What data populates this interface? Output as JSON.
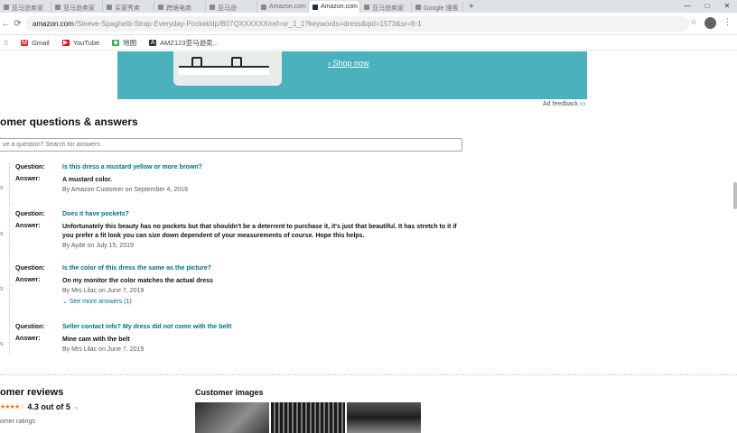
{
  "browser": {
    "tabs": [
      {
        "label": "亚马逊卖家",
        "active": false
      },
      {
        "label": "亚马逊卖家",
        "active": false
      },
      {
        "label": "买家秀卖",
        "active": false
      },
      {
        "label": "跨境电商",
        "active": false
      },
      {
        "label": "亚马逊",
        "active": false
      },
      {
        "label": "Amazon.com",
        "active": false
      },
      {
        "label": "Amazon.com",
        "active": true
      },
      {
        "label": "亚马逊卖家",
        "active": false
      },
      {
        "label": "Google 搜索",
        "active": false
      }
    ],
    "new_tab": "+",
    "controls": {
      "minimize": "—",
      "maximize": "□",
      "close": "✕"
    },
    "nav": {
      "back": "←",
      "forward": "→",
      "reload": "⟳"
    },
    "url_host": "amazon.com",
    "url_path": "/Sleeve-Spaghetti-Strap-Everyday-Pocket/dp/B07QXXXXXX/ref=sr_1_1?keywords=dress&qid=1573&sr=8-1",
    "bookmarks": [
      {
        "label": "Gmail",
        "icon": "gmail-icon"
      },
      {
        "label": "YouTube",
        "icon": "youtube-icon"
      },
      {
        "label": "地图",
        "icon": "maps-icon"
      },
      {
        "label": "AMZ123亚马逊卖...",
        "icon": "amz-icon"
      }
    ]
  },
  "ad": {
    "shop_now": "› Shop now",
    "feedback": "Ad feedback"
  },
  "qa": {
    "title": "omer questions & answers",
    "search_placeholder": "ve a question? Search for answers",
    "question_label": "Question:",
    "answer_label": "Answer:",
    "items": [
      {
        "q": "Is this dress a mustard yellow or more brown?",
        "a": "A mustard color.",
        "by": "By Amazon Customer on September 4, 2019",
        "more": ""
      },
      {
        "q": "Does it have pockets?",
        "a": "Unfortunately this beauty has no pockets but that shouldn't be a deterrent to purchase it, it's just that beautiful. It has stretch to it if you prefer a fit look you can size down dependent of your measurements of course. Hope this helps.",
        "by": "By Ayde on July 15, 2019",
        "more": ""
      },
      {
        "q": "Is the color of this dress the same as the picture?",
        "a": "On my monitor the color matches the actual dress",
        "by": "By Mrs Lilac on June 7, 2019",
        "more": "⌄ See more answers (1)"
      },
      {
        "q": "Seller contact info? My dress did not come with the belt!",
        "a": "Mine cam with the belt",
        "by": "By Mrs Lilac on June 7, 2019",
        "more": ""
      }
    ]
  },
  "reviews": {
    "title": "omer reviews",
    "stars": "★★★★☆",
    "rating": "4.3 out of 5",
    "count": "omer ratings"
  },
  "customer_images": {
    "title": "Customer images"
  },
  "colors": {
    "link": "#007185",
    "banner": "#4bb1bd",
    "star": "#de7921"
  }
}
